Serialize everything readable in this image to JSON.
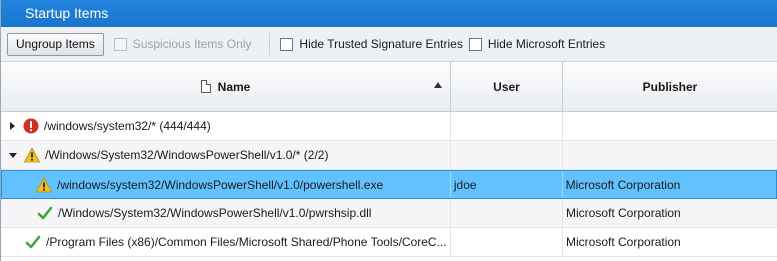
{
  "window": {
    "title": "Startup Items"
  },
  "toolbar": {
    "ungroup_label": "Ungroup Items",
    "suspicious_label": "Suspicious Items Only",
    "hide_trusted_label": "Hide Trusted Signature Entries",
    "hide_microsoft_label": "Hide Microsoft Entries"
  },
  "columns": {
    "name": "Name",
    "user": "User",
    "publisher": "Publisher"
  },
  "rows": [
    {
      "name": "/windows/system32/* (444/444)",
      "user": "",
      "publisher": ""
    },
    {
      "name": "/Windows/System32/WindowsPowerShell/v1.0/* (2/2)",
      "user": "",
      "publisher": ""
    },
    {
      "name": "/windows/system32/WindowsPowerShell/v1.0/powershell.exe",
      "user": "jdoe",
      "publisher": "Microsoft Corporation"
    },
    {
      "name": "/Windows/System32/WindowsPowerShell/v1.0/pwrshsip.dll",
      "user": "",
      "publisher": "Microsoft Corporation"
    },
    {
      "name": "/Program Files (x86)/Common Files/Microsoft Shared/Phone Tools/CoreC...",
      "user": "",
      "publisher": "Microsoft Corporation"
    }
  ],
  "colors": {
    "titlebar": "#1f80da",
    "selection": "#62c2ff",
    "error": "#d62c1f",
    "warning": "#f2c21b",
    "ok": "#3aa935"
  }
}
